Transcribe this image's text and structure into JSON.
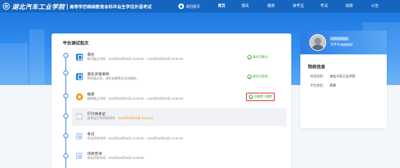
{
  "header": {
    "school_name": "湖北汽车工业学院",
    "system_title": "高等学历继续教育本科毕业生学位外语考试",
    "back_home": "返回首页",
    "nav": [
      {
        "label": "首页",
        "active": true
      },
      {
        "label": "报名",
        "active": false
      },
      {
        "label": "缴费",
        "active": false
      },
      {
        "label": "准考证",
        "active": false
      },
      {
        "label": "考试",
        "active": false
      },
      {
        "label": "成绩",
        "active": false
      },
      {
        "label": "公告",
        "active": false
      }
    ]
  },
  "main": {
    "title": "平台测试批次",
    "steps": [
      {
        "title": "报名",
        "desc": "报名截止时间：2023年09月05日 16:00:00 ~ 2023年09月08日 00:00:00",
        "status": "报名已确认",
        "icon": "register-icon"
      },
      {
        "title": "报名资格审核",
        "desc": "审核通过后，请检查缴费信息准确性。",
        "status": "报名已审核",
        "icon": "review-icon"
      },
      {
        "title": "缴费",
        "desc": "缴费截止时间：2023年09月01日 16:00:00 ~ 2023年09月06日 10:00:00",
        "status": "待缴费 / 缴费",
        "icon": "payment-icon"
      },
      {
        "title": "打印准考证",
        "desc_prefix": "准考证打印开始时间：",
        "desc_highlight": "2023年09月06日 10:00:00",
        "icon": "print-ticket-icon"
      },
      {
        "title": "考试",
        "desc": "考试开始时间：2023年09月06日 11:00:00 ~ 2023年09月06日 12:00:00",
        "icon": "exam-icon"
      },
      {
        "title": "成绩查询",
        "desc": "查询开始时间：2023年09月06日 23:59:59",
        "icon": "score-icon"
      }
    ]
  },
  "side": {
    "id_label": "证件号",
    "title": "院校信息",
    "school_label": "就读院校：",
    "school_value": "湖北汽车工业学院",
    "type_label": "学生类型：",
    "type_value": "成教"
  },
  "colors": {
    "nav_blue": "#1565c0",
    "timeline_blue": "#2f7de1",
    "success_green": "#3fa33a",
    "highlight_red": "#d8232a",
    "warning_orange": "#f7941d"
  }
}
